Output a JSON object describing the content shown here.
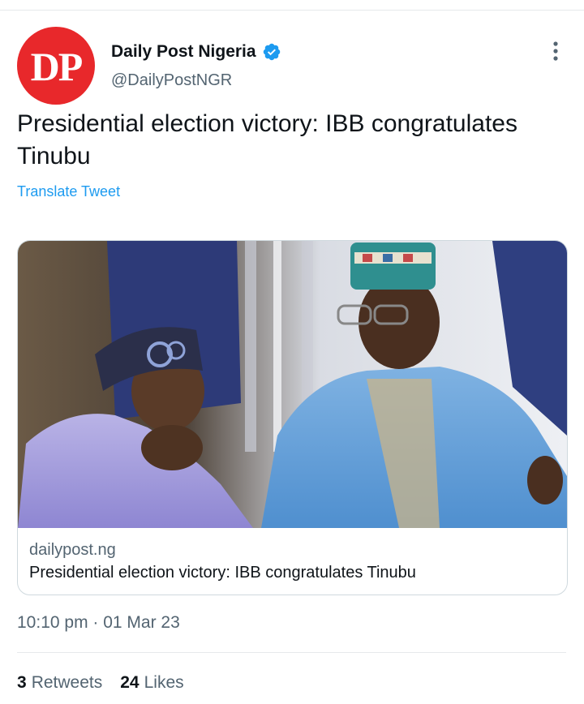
{
  "tweet": {
    "author": {
      "display_name": "Daily Post Nigeria",
      "handle": "@DailyPostNGR",
      "avatar_text": "DP",
      "avatar_color": "#e8282b",
      "verified": true
    },
    "text": "Presidential election victory: IBB congratulates Tinubu",
    "translate_label": "Translate Tweet",
    "card": {
      "domain": "dailypost.ng",
      "title": "Presidential election victory: IBB congratulates Tinubu"
    },
    "timestamp": "10:10 pm · 01 Mar 23",
    "stats": {
      "retweets_count": "3",
      "retweets_label": "Retweets",
      "likes_count": "24",
      "likes_label": "Likes"
    }
  },
  "colors": {
    "link": "#1d9bf0",
    "secondary_text": "#536471",
    "primary_text": "#0f1419"
  },
  "icons": {
    "verified": "verified-badge-icon",
    "more": "more-vertical-icon"
  }
}
